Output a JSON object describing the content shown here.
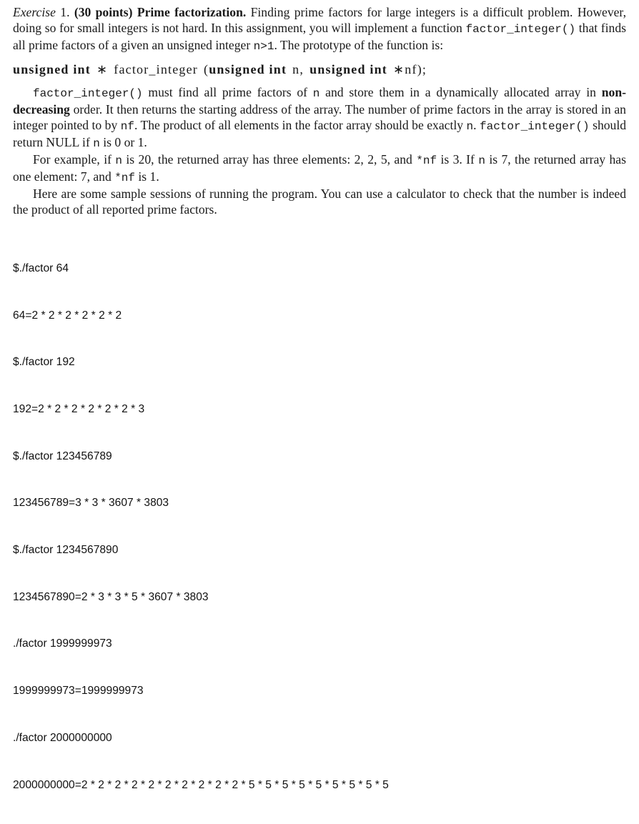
{
  "exercise": {
    "label": "Exercise",
    "number": "1.",
    "points": "(30 points)",
    "title": "Prime factorization.",
    "intro_1": "Finding prime factors for large integers is a difficult problem. However, doing so for small integers is not hard. In this assignment, you will implement a function",
    "intro_fn": "factor_integer()",
    "intro_2": "that finds all prime factors of a given an unsigned integer",
    "intro_cond": "n>1",
    "intro_3": ". The prototype of the function is:"
  },
  "prototype": {
    "ret_type": "unsigned int",
    "star": "∗",
    "fn_name": "factor_integer",
    "open": "(",
    "p1_type": "unsigned int",
    "p1_name": "n,",
    "p2_type": "unsigned int",
    "p2_name": "∗nf);"
  },
  "para2": {
    "fn": "factor_integer()",
    "t1": "must find all prime factors of",
    "n1": "n",
    "t2": "and store them in a dynamically allocated array in",
    "bold": "non-decreasing",
    "t3": "order. It then returns the starting address of the array. The number of prime factors in the array is stored in an integer pointed to by",
    "nf": "nf",
    "t4": ". The product of all elements in the factor array should be exactly",
    "n2": "n",
    "t5": ".",
    "fn2": "factor_integer()",
    "t6": "should return NULL if",
    "n3": "n",
    "t7": "is 0 or 1."
  },
  "para3": {
    "t1": "For example, if",
    "n1": "n",
    "t2": "is 20, the returned array has three elements: 2, 2, 5, and",
    "nf1": "*nf",
    "t3": "is 3. If",
    "n2": "n",
    "t4": "is 7, the returned array has one element: 7, and",
    "nf2": "*nf",
    "t5": "is 1."
  },
  "para4": {
    "text": "Here are some sample sessions of running the program. You can use a calculator to check that the number is indeed the product of all reported prime factors."
  },
  "session": {
    "lines": [
      "$./factor 64",
      "64=2 * 2 * 2 * 2 * 2 * 2",
      "$./factor 192",
      "192=2 * 2 * 2 * 2 * 2 * 2 * 3",
      "$./factor 123456789",
      "123456789=3 * 3 * 3607 * 3803",
      "$./factor 1234567890",
      "1234567890=2 * 3 * 3 * 5 * 3607 * 3803",
      "./factor 1999999973",
      "1999999973=1999999973",
      "./factor 2000000000",
      "2000000000=2 * 2 * 2 * 2 * 2 * 2 * 2 * 2 * 2 * 2 * 5 * 5 * 5 * 5 * 5 * 5 * 5 * 5 * 5"
    ]
  }
}
